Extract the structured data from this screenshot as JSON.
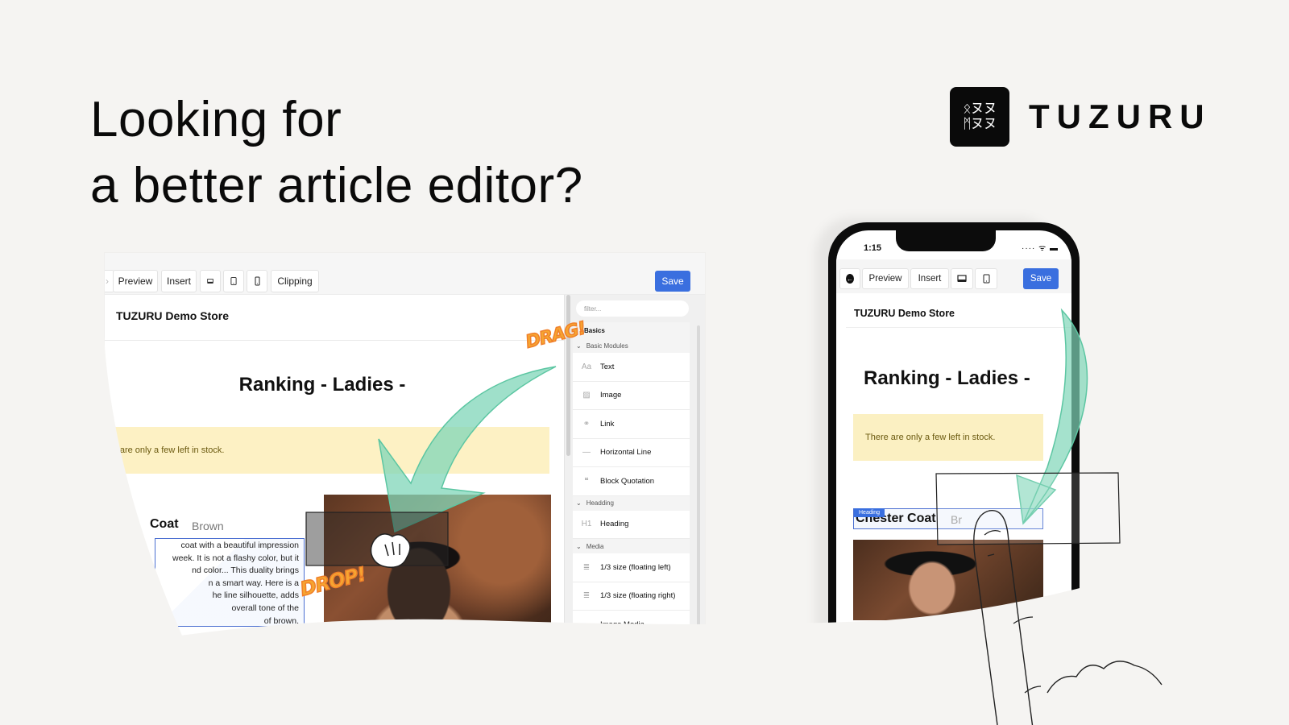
{
  "hero": {
    "headline_line1": "Looking for",
    "headline_line2": "a better article editor?"
  },
  "brand": {
    "logo_glyph_line1": "ᛟヌヌ",
    "logo_glyph_line2": "ᛗヌヌ",
    "name": "TUZURU"
  },
  "desktop_editor": {
    "toolbar": {
      "back_partial": "›",
      "preview": "Preview",
      "insert": "Insert",
      "desktop_view_icon": "desktop-icon",
      "tablet_view_icon": "tablet-icon",
      "mobile_view_icon": "mobile-icon",
      "clipping": "Clipping",
      "save": "Save"
    },
    "canvas": {
      "store_name": "TUZURU Demo Store",
      "ranking_title": "Ranking - Ladies -",
      "stock_notice": "re are only a few left in stock.",
      "product_title": "Coat",
      "product_color": "Brown",
      "description_lines": [
        "coat with a beautiful impression",
        "week. It is not a flashy color, but it",
        "nd color... This duality brings",
        "n a smart way. Here is a",
        "he line silhouette, adds",
        "overall tone of the",
        "of brown."
      ]
    },
    "module_panel": {
      "filter_placeholder": "filter...",
      "section_basics": "Basics",
      "group_basic_modules": "Basic Modules",
      "basic_items": [
        {
          "icon": "Aa",
          "label": "Text"
        },
        {
          "icon": "▨",
          "label": "Image"
        },
        {
          "icon": "⚭",
          "label": "Link"
        },
        {
          "icon": "—",
          "label": "Horizontal Line"
        },
        {
          "icon": "❝",
          "label": "Block Quotation"
        }
      ],
      "group_heading": "Headding",
      "heading_items": [
        {
          "icon": "H1",
          "label": "Heading"
        }
      ],
      "group_media": "Media",
      "media_items": [
        {
          "icon": "≣",
          "label": "1/3 size (floating left)"
        },
        {
          "icon": "≣",
          "label": "1/3 size (floating right)"
        },
        {
          "icon": "▭",
          "label": "Image Media"
        }
      ]
    },
    "stickers": {
      "drag": "DRAG!",
      "drop": "DROP!"
    }
  },
  "phone_editor": {
    "status_time": "1:15",
    "status_icons": "···· ᯤ ▬",
    "toolbar": {
      "back": "←",
      "preview": "Preview",
      "insert": "Insert",
      "save": "Save"
    },
    "store_name": "TUZURU Demo Store",
    "ranking_title": "Ranking - Ladies -",
    "stock_notice": "There are only a few left in stock.",
    "heading_tag": "Heading",
    "product_title": "Chester Coat",
    "product_color": "Br"
  },
  "colors": {
    "background": "#f5f4f2",
    "accent_blue": "#3a6fdf",
    "notice_yellow": "#fdf1c4",
    "arrow_green": "#7fd6b8",
    "sticker_orange": "#f6a531"
  }
}
